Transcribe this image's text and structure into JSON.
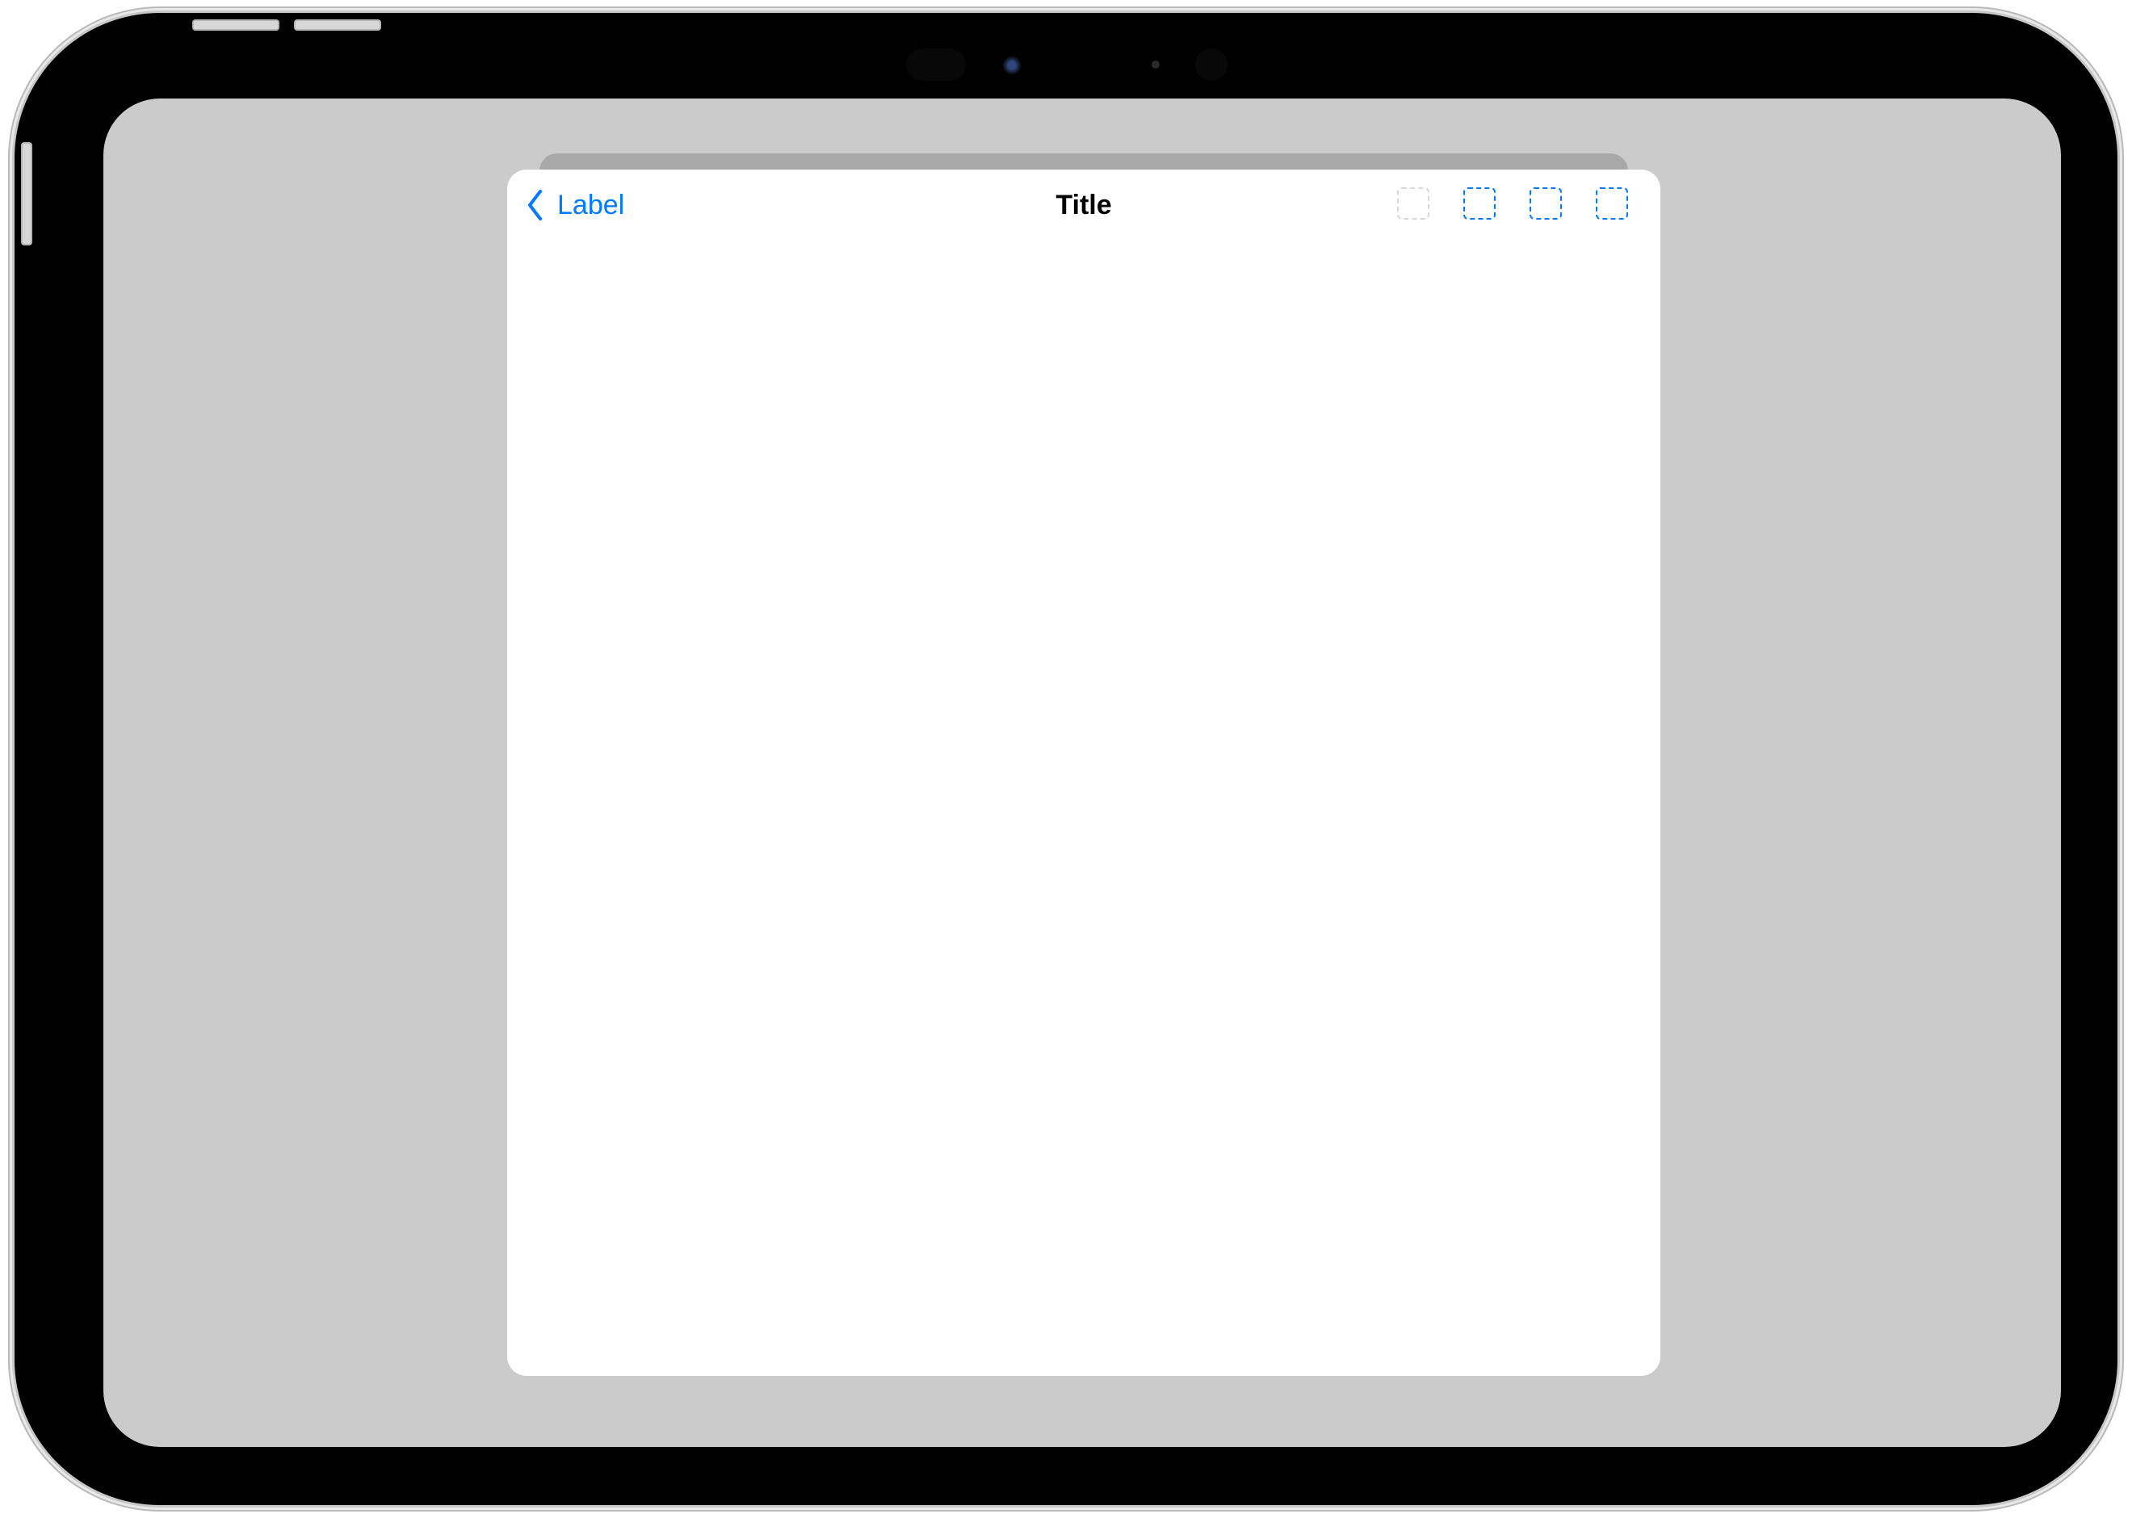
{
  "navbar": {
    "back_label": "Label",
    "title": "Title",
    "actions": [
      {
        "icon": "placeholder-square-icon",
        "state": "disabled"
      },
      {
        "icon": "placeholder-square-icon",
        "state": "enabled"
      },
      {
        "icon": "placeholder-square-icon",
        "state": "enabled"
      },
      {
        "icon": "placeholder-square-icon",
        "state": "enabled"
      }
    ]
  },
  "colors": {
    "accent": "#007AFF",
    "sheet": "#FFFFFF",
    "background": "#CBCBCB",
    "device": "#000000"
  }
}
